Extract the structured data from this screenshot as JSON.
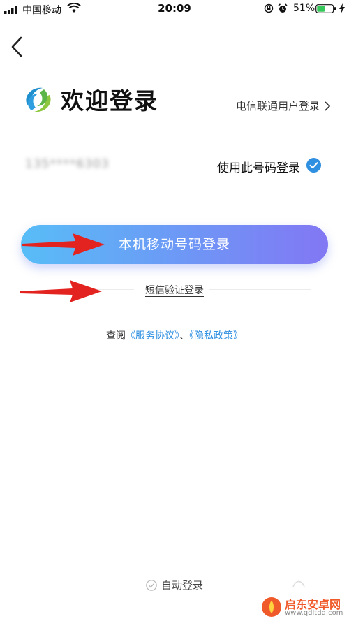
{
  "status_bar": {
    "carrier": "中国移动",
    "time": "20:09",
    "battery_percent": "51%",
    "battery_level": 0.51,
    "icons": [
      "signal-icon",
      "wifi-icon",
      "rotation-lock-icon",
      "alarm-icon",
      "battery-icon",
      "charging-icon"
    ]
  },
  "header": {
    "back_icon": "chevron-left-icon",
    "logo_icon": "china-mobile-logo",
    "title": "欢迎登录",
    "telecom_link": "电信联通用户登录"
  },
  "phone": {
    "number": "135****6303",
    "use_number_label": "使用此号码登录",
    "checked": true
  },
  "buttons": {
    "primary_login": "本机移动号码登录",
    "sms_login": "短信验证登录"
  },
  "agreement": {
    "prefix": "查阅",
    "service": "《服务协议》",
    "separator": "、",
    "privacy": "《隐私政策》"
  },
  "footer": {
    "auto_login": "自动登录",
    "auto_login_checked": true
  },
  "watermark": {
    "name": "启东安卓网",
    "url": "www.qdltdq.com"
  },
  "colors": {
    "gradient_start": "#58bdf7",
    "gradient_end": "#8277f4",
    "link_blue": "#2f8fe0",
    "check_blue": "#2f8fe0",
    "arrow_red": "#e3231f"
  }
}
